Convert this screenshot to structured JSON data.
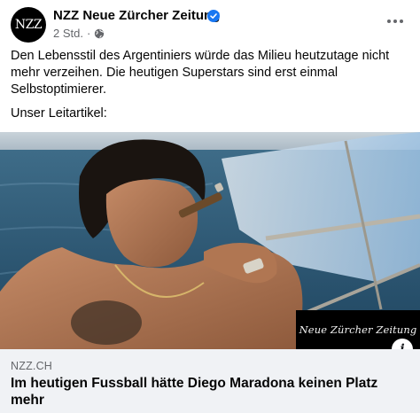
{
  "header": {
    "avatar_text": "NZZ",
    "page_name": "NZZ Neue Zürcher Zeitung",
    "verified_icon": "verified-badge-icon",
    "timestamp": "2 Std.",
    "separator": "·",
    "audience_icon": "globe-icon",
    "more_icon": "more-options-icon"
  },
  "post": {
    "paragraphs": [
      "Den Lebensstil des Argentiniers würde das Milieu heutzutage nicht mehr verzeihen. Die heutigen Superstars sind erst einmal Selbstoptimierer.",
      "Unser Leitartikel:"
    ]
  },
  "image": {
    "watermark": "Neue Zürcher Zeitung",
    "info_icon": "i"
  },
  "link_preview": {
    "domain": "NZZ.CH",
    "headline": "Im heutigen Fussball hätte Diego Maradona keinen Platz mehr"
  },
  "colors": {
    "brand_blue": "#1877f2",
    "secondary_text": "#65676b",
    "preview_bg": "#f0f2f5"
  }
}
